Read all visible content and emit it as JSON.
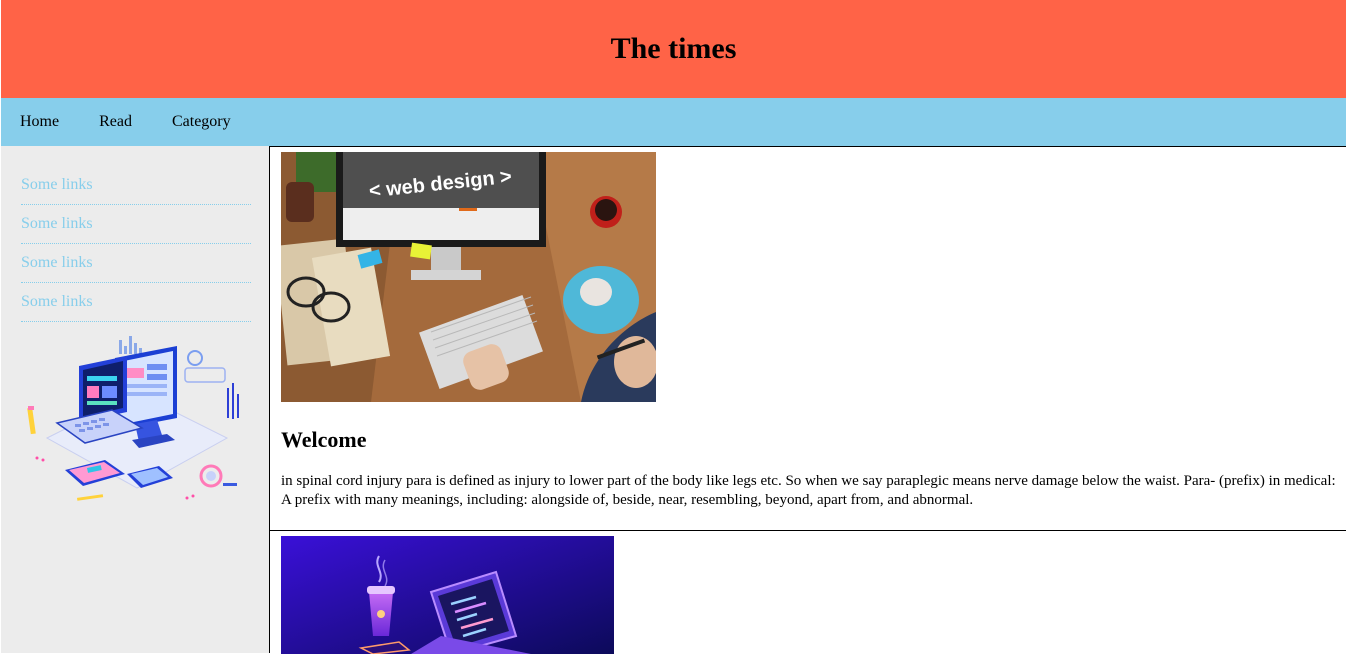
{
  "header": {
    "title": "The times"
  },
  "nav": {
    "items": [
      "Home",
      "Read",
      "Category"
    ]
  },
  "sidebar": {
    "links": [
      "Some links",
      "Some links",
      "Some links",
      "Some links"
    ]
  },
  "main": {
    "article": {
      "image_text": "< web design >",
      "title": "Welcome",
      "body": "in spinal cord injury para is defined as injury to lower part of the body like legs etc. So when we say paraplegic means nerve damage below the waist. Para- (prefix) in medical: A prefix with many meanings, including: alongside of, beside, near, resembling, beyond, apart from, and abnormal."
    }
  },
  "colors": {
    "header_bg": "#ff6347",
    "nav_bg": "#87ceeb",
    "sidebar_bg": "#ececec",
    "link": "#87ceeb"
  }
}
